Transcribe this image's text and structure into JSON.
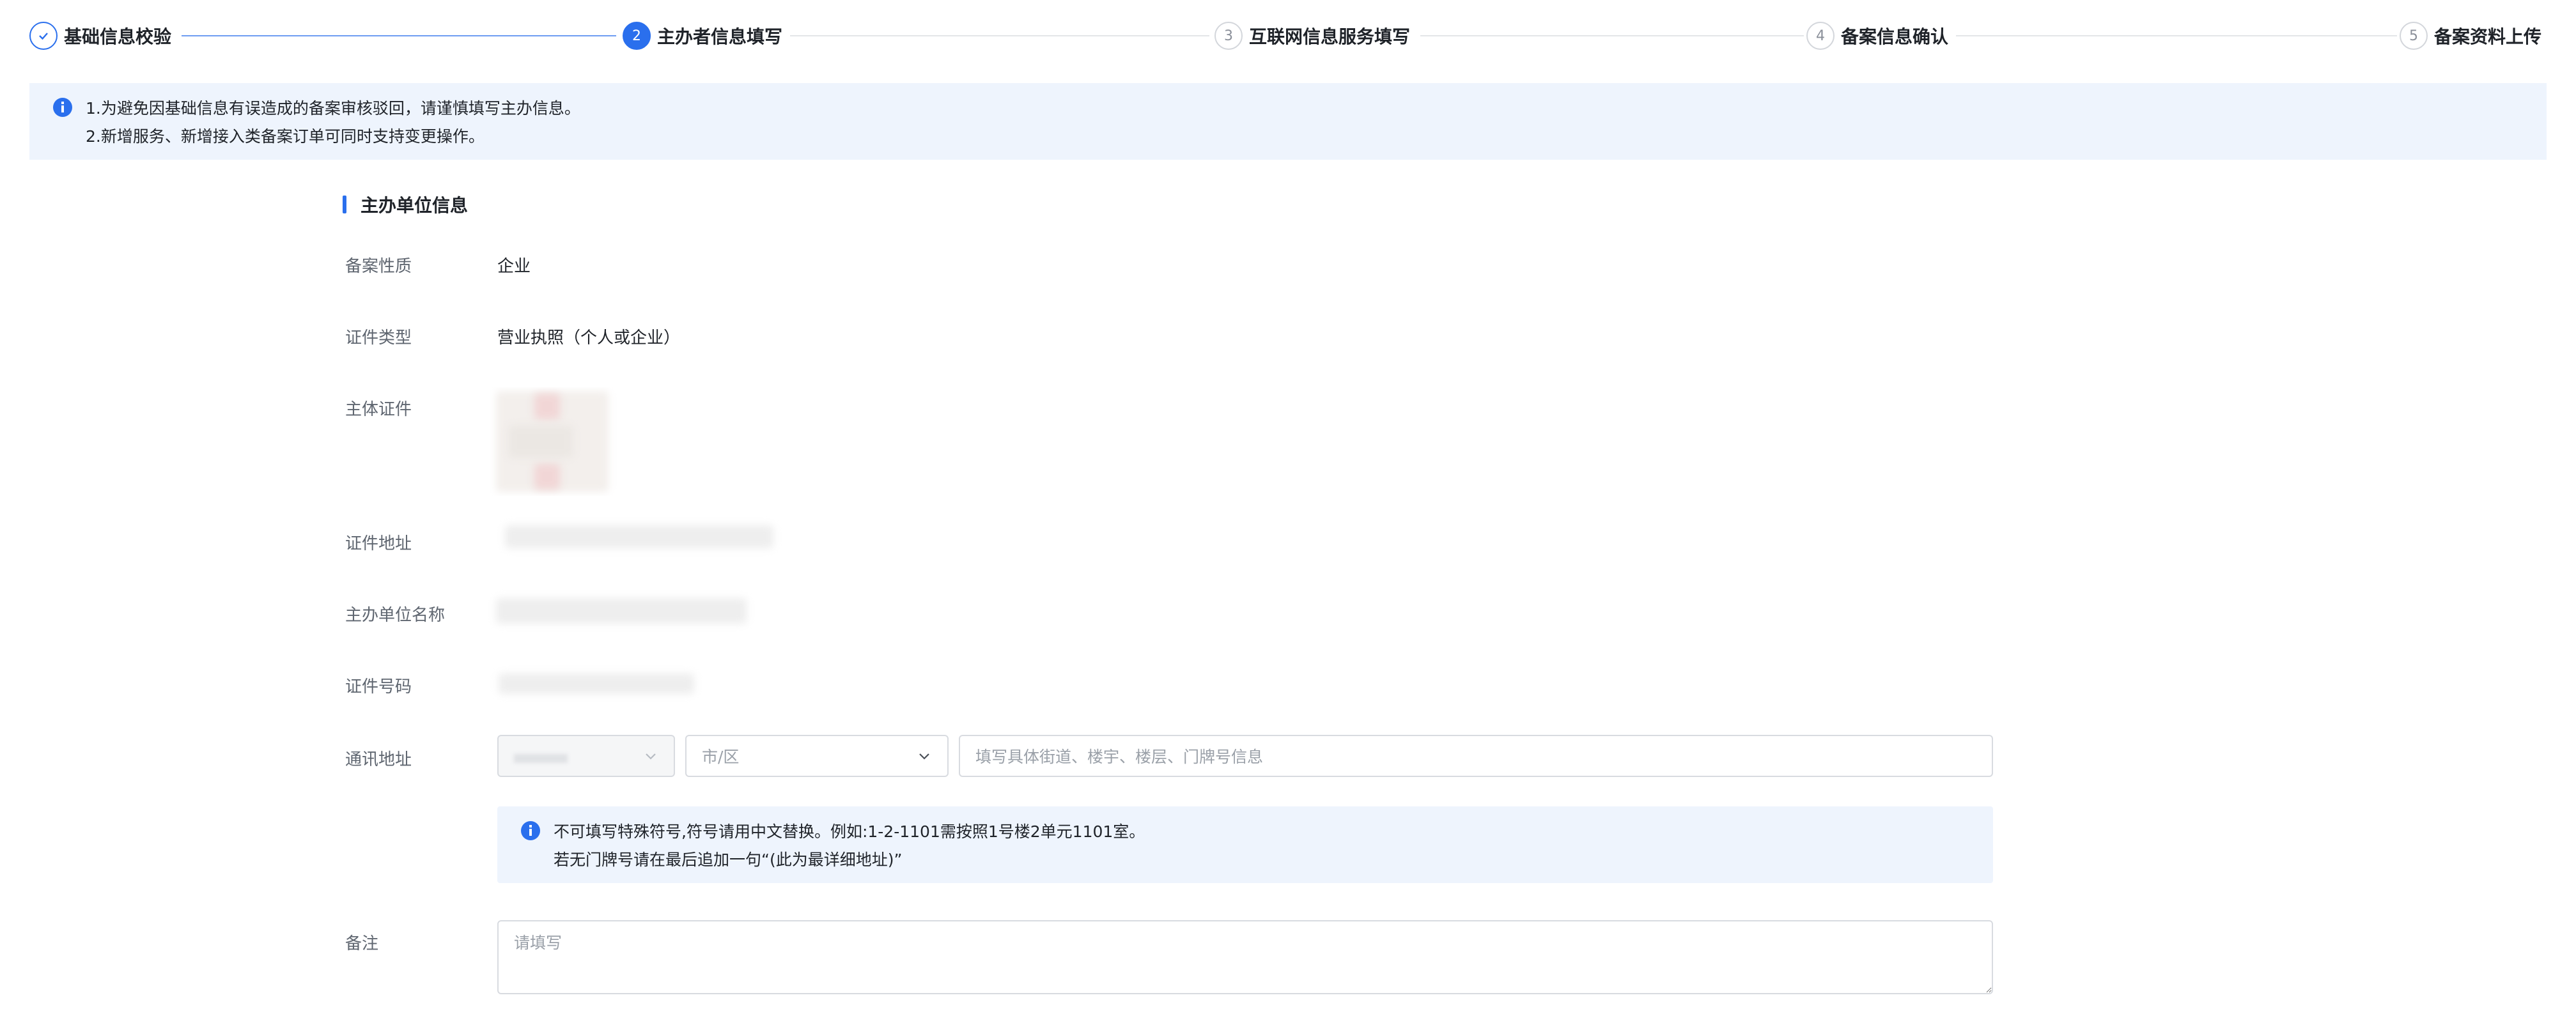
{
  "steps": [
    {
      "num": "1",
      "label": "基础信息校验",
      "state": "done"
    },
    {
      "num": "2",
      "label": "主办者信息填写",
      "state": "active"
    },
    {
      "num": "3",
      "label": "互联网信息服务填写",
      "state": "pending"
    },
    {
      "num": "4",
      "label": "备案信息确认",
      "state": "pending"
    },
    {
      "num": "5",
      "label": "备案资料上传",
      "state": "pending"
    }
  ],
  "notice": {
    "line1": "1.为避免因基础信息有误造成的备案审核驳回，请谨慎填写主办信息。",
    "line2": "2.新增服务、新增接入类备案订单可同时支持变更操作。"
  },
  "section": {
    "title": "主办单位信息"
  },
  "fields": {
    "nature": {
      "label": "备案性质",
      "value": "企业"
    },
    "cert_type": {
      "label": "证件类型",
      "value": "营业执照（个人或企业）"
    },
    "cert_image": {
      "label": "主体证件"
    },
    "cert_address": {
      "label": "证件地址"
    },
    "org_name": {
      "label": "主办单位名称"
    },
    "cert_number": {
      "label": "证件号码"
    },
    "mail_address": {
      "label": "通讯地址",
      "city_placeholder": "市/区",
      "detail_placeholder": "填写具体街道、楼宇、楼层、门牌号信息"
    },
    "remark": {
      "label": "备注",
      "placeholder": "请填写"
    }
  },
  "address_tip": {
    "line1": "不可填写特殊符号,符号请用中文替换。例如:1-2-1101需按照1号楼2单元1101室。",
    "line2": "若无门牌号请在最后追加一句“(此为最详细地址)”"
  },
  "colors": {
    "accent": "#2a6fed",
    "notice_bg": "#eef4fd",
    "border": "#d8dbe0"
  }
}
